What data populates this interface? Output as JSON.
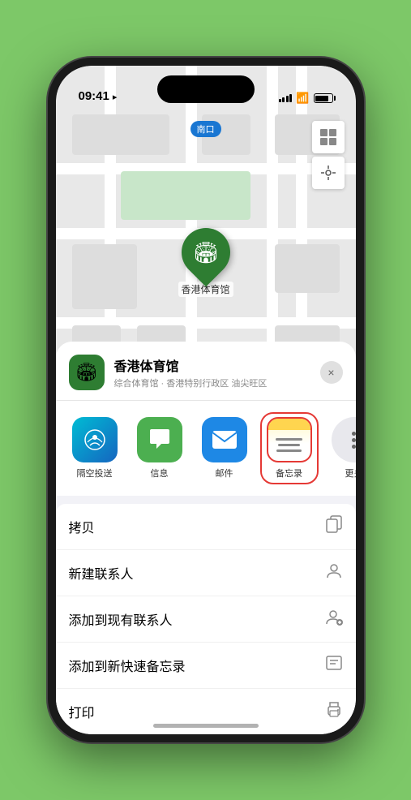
{
  "status": {
    "time": "09:41",
    "location_arrow": "▶"
  },
  "map": {
    "north_label": "南口",
    "map_icon": "🗺",
    "location_icon": "⌖"
  },
  "venue": {
    "name": "香港体育馆",
    "subtitle": "综合体育馆 · 香港特别行政区 油尖旺区",
    "icon": "🏟"
  },
  "share_items": [
    {
      "id": "airdrop",
      "label": "隔空投送",
      "type": "airdrop"
    },
    {
      "id": "messages",
      "label": "信息",
      "type": "messages"
    },
    {
      "id": "mail",
      "label": "邮件",
      "type": "mail"
    },
    {
      "id": "notes",
      "label": "备忘录",
      "type": "notes"
    }
  ],
  "actions": [
    {
      "id": "copy",
      "label": "拷贝",
      "icon": "⎘"
    },
    {
      "id": "new-contact",
      "label": "新建联系人",
      "icon": "👤"
    },
    {
      "id": "add-contact",
      "label": "添加到现有联系人",
      "icon": "👤"
    },
    {
      "id": "quick-note",
      "label": "添加到新快速备忘录",
      "icon": "📋"
    },
    {
      "id": "print",
      "label": "打印",
      "icon": "🖨"
    }
  ],
  "close_label": "×",
  "more_label": "更多"
}
